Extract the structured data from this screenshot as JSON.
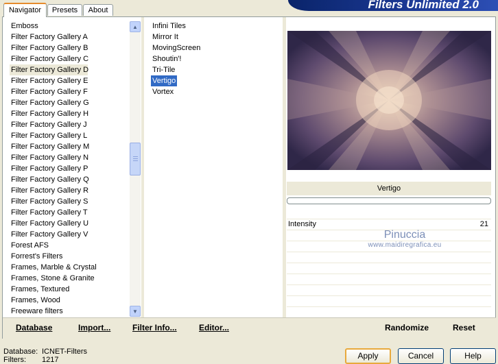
{
  "app": {
    "title": "Filters Unlimited 2.0"
  },
  "tabs": [
    {
      "label": "Navigator",
      "active": true
    },
    {
      "label": "Presets",
      "active": false
    },
    {
      "label": "About",
      "active": false
    }
  ],
  "categories": [
    "Emboss",
    "Filter Factory Gallery A",
    "Filter Factory Gallery B",
    "Filter Factory Gallery C",
    "Filter Factory Gallery D",
    "Filter Factory Gallery E",
    "Filter Factory Gallery F",
    "Filter Factory Gallery G",
    "Filter Factory Gallery H",
    "Filter Factory Gallery J",
    "Filter Factory Gallery L",
    "Filter Factory Gallery M",
    "Filter Factory Gallery N",
    "Filter Factory Gallery P",
    "Filter Factory Gallery Q",
    "Filter Factory Gallery R",
    "Filter Factory Gallery S",
    "Filter Factory Gallery T",
    "Filter Factory Gallery U",
    "Filter Factory Gallery V",
    "Forest AFS",
    "Forrest's Filters",
    "Frames, Marble & Crystal",
    "Frames, Stone & Granite",
    "Frames, Textured",
    "Frames, Wood",
    "Freeware filters"
  ],
  "selected_category_index": 4,
  "filters": [
    "Infini Tiles",
    "Mirror It",
    "MovingScreen",
    "Shoutin'!",
    "Tri-Tile",
    "Vertigo",
    "Vortex"
  ],
  "selected_filter_index": 5,
  "preview": {
    "filter_name": "Vertigo"
  },
  "parameters": [
    {
      "name": "Intensity",
      "value": "21"
    }
  ],
  "watermark": {
    "line1": "Pinuccia",
    "line2": "www.maidiregrafica.eu"
  },
  "bottom_buttons": {
    "database": "Database",
    "import": "Import...",
    "filter_info": "Filter Info...",
    "editor": "Editor...",
    "randomize": "Randomize",
    "reset": "Reset"
  },
  "status": {
    "database_label": "Database:",
    "database_value": "ICNET-Filters",
    "filters_label": "Filters:",
    "filters_value": "1217"
  },
  "dialog_buttons": {
    "apply": "Apply",
    "cancel": "Cancel",
    "help": "Help"
  },
  "colors": {
    "selection": "#316ac5",
    "tab_highlight": "#e68b2c",
    "banner": "#0a246a"
  }
}
